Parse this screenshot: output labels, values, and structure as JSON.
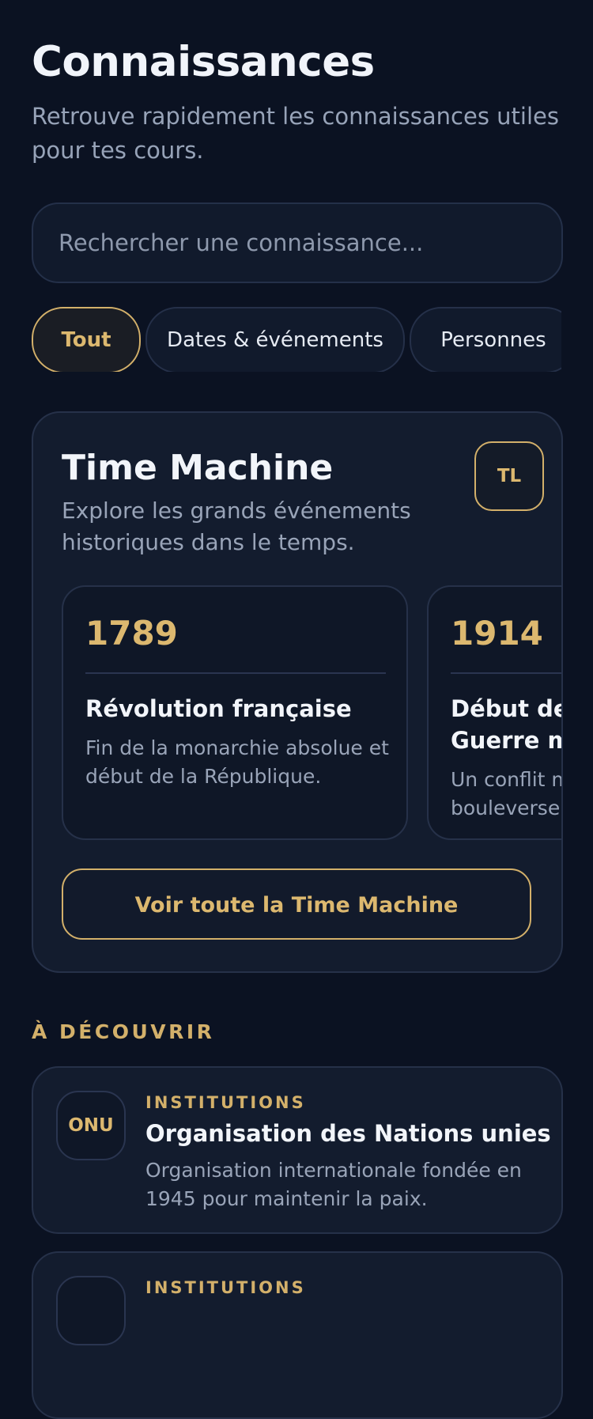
{
  "header": {
    "title": "Connaissances",
    "subtitle": "Retrouve rapidement les connaissances utiles pour tes cours."
  },
  "search": {
    "placeholder": "Rechercher une connaissance...",
    "value": ""
  },
  "filters": [
    {
      "label": "Tout",
      "active": true
    },
    {
      "label": "Dates & événements",
      "active": false
    },
    {
      "label": "Personnes",
      "active": false
    }
  ],
  "time_machine": {
    "title": "Time Machine",
    "subtitle": "Explore les grands événements historiques dans le temps.",
    "badge": "TL",
    "events": [
      {
        "year": "1789",
        "title": "Révolution française",
        "description": "Fin de la monarchie absolue et début de la République."
      },
      {
        "year": "1914",
        "title": "Début de la Première Guerre mondiale",
        "description": "Un conflit mondial qui bouleverse l'Europe."
      }
    ],
    "button_label": "Voir toute la Time Machine"
  },
  "discover": {
    "section_label": "À DÉCOUVRIR",
    "items": [
      {
        "badge": "ONU",
        "category": "INSTITUTIONS",
        "title": "Organisation des Nations unies",
        "description": "Organisation internationale fondée en 1945 pour maintenir la paix."
      },
      {
        "badge": "",
        "category": "INSTITUTIONS",
        "title": "",
        "description": ""
      }
    ]
  },
  "colors": {
    "background": "#0b1222",
    "card": "#131c2e",
    "accent": "#d3b06a",
    "text_primary": "#f1f4fa",
    "text_secondary": "#97a3b8"
  }
}
